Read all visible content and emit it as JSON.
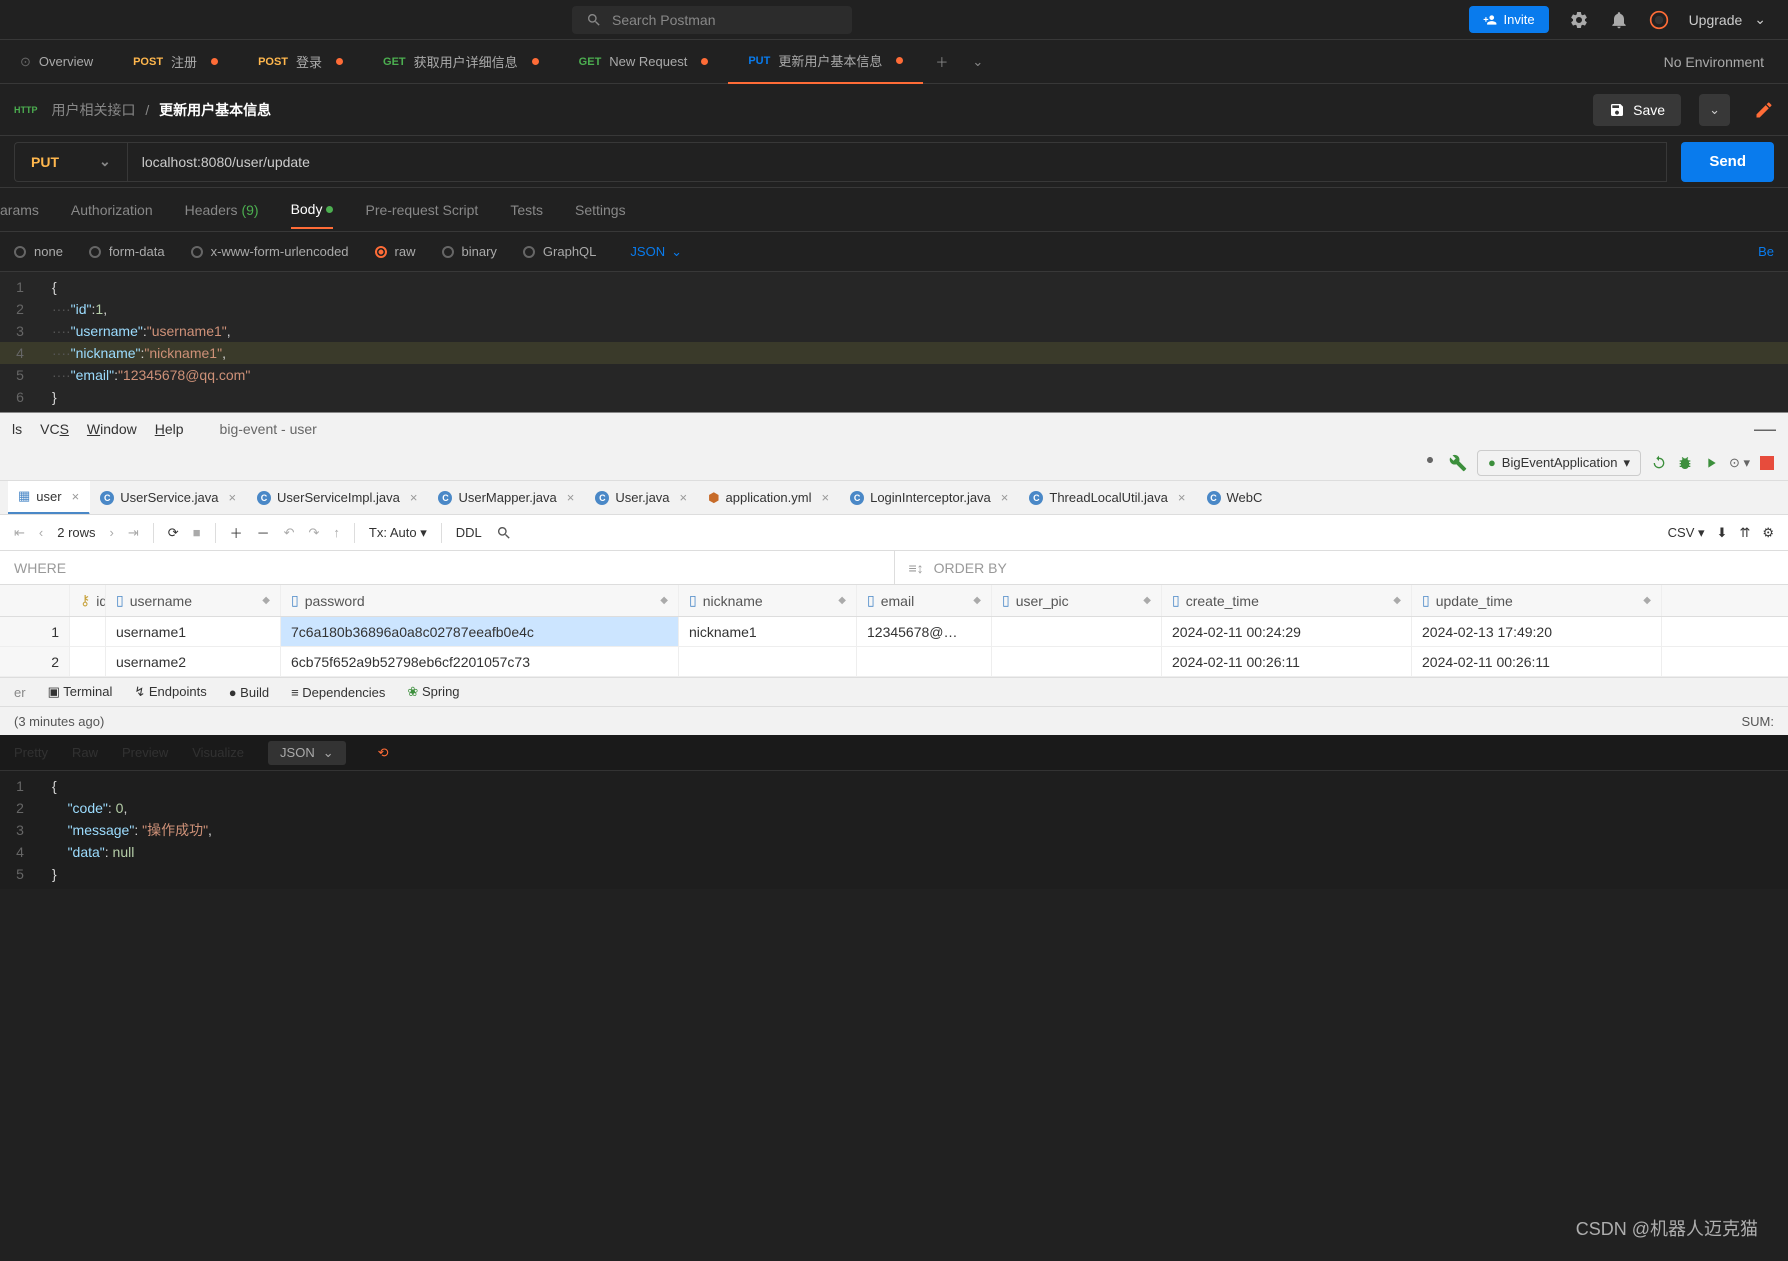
{
  "header": {
    "search_placeholder": "Search Postman",
    "invite_label": "Invite",
    "upgrade_label": "Upgrade"
  },
  "tabs": {
    "overview": "Overview",
    "items": [
      {
        "method": "POST",
        "label": "注册",
        "modified": true
      },
      {
        "method": "POST",
        "label": "登录",
        "modified": true
      },
      {
        "method": "GET",
        "label": "获取用户详细信息",
        "modified": true
      },
      {
        "method": "GET",
        "label": "New Request",
        "modified": true
      },
      {
        "method": "PUT",
        "label": "更新用户基本信息",
        "modified": true,
        "active": true
      }
    ],
    "no_environment": "No Environment"
  },
  "breadcrumb": {
    "http": "HTTP",
    "folder": "用户相关接口",
    "current": "更新用户基本信息",
    "save": "Save"
  },
  "request": {
    "method": "PUT",
    "url": "localhost:8080/user/update",
    "send": "Send"
  },
  "req_tabs": {
    "params": "Params",
    "auth": "Authorization",
    "headers": "Headers",
    "headers_count": "(9)",
    "body": "Body",
    "prerequest": "Pre-request Script",
    "tests": "Tests",
    "settings": "Settings"
  },
  "body_types": {
    "none": "none",
    "form": "form-data",
    "xwww": "x-www-form-urlencoded",
    "raw": "raw",
    "binary": "binary",
    "graphql": "GraphQL",
    "json": "JSON",
    "beautify": "Be"
  },
  "request_body": {
    "l1": "{",
    "l2_k": "\"id\"",
    "l2_v": "1",
    "l3_k": "\"username\"",
    "l3_v": "\"username1\"",
    "l4_k": "\"nickname\"",
    "l4_v": "\"nickname1\"",
    "l5_k": "\"email\"",
    "l5_v": "\"12345678@qq.com\"",
    "l6": "}"
  },
  "ide": {
    "menu": {
      "vcs": "VCS",
      "window": "Window",
      "help": "Help",
      "project": "big-event - user",
      "ls": "ls"
    },
    "run_config": "BigEventApplication",
    "tabs": [
      {
        "icon": "db",
        "label": "user",
        "active": true
      },
      {
        "icon": "c",
        "label": "UserService.java"
      },
      {
        "icon": "c",
        "label": "UserServiceImpl.java"
      },
      {
        "icon": "c",
        "label": "UserMapper.java"
      },
      {
        "icon": "c",
        "label": "User.java"
      },
      {
        "icon": "y",
        "label": "application.yml"
      },
      {
        "icon": "c",
        "label": "LoginInterceptor.java"
      },
      {
        "icon": "c",
        "label": "ThreadLocalUtil.java"
      },
      {
        "icon": "c",
        "label": "WebC"
      }
    ],
    "toolbar": {
      "rows": "2 rows",
      "tx": "Tx: Auto",
      "ddl": "DDL",
      "csv": "CSV"
    },
    "filters": {
      "where": "WHERE",
      "orderby": "ORDER BY"
    },
    "columns": [
      "id",
      "username",
      "password",
      "nickname",
      "email",
      "user_pic",
      "create_time",
      "update_time"
    ],
    "rows": [
      {
        "idx": "1",
        "id": "",
        "username": "username1",
        "password": "7c6a180b36896a0a8c02787eeafb0e4c",
        "nickname": "nickname1",
        "email": "12345678@…",
        "user_pic": "",
        "create_time": "2024-02-11 00:24:29",
        "update_time": "2024-02-13 17:49:20"
      },
      {
        "idx": "2",
        "id": "",
        "username": "username2",
        "password": "6cb75f652a9b52798eb6cf2201057c73",
        "nickname": "",
        "email": "",
        "user_pic": "",
        "create_time": "2024-02-11 00:26:11",
        "update_time": "2024-02-11 00:26:11"
      }
    ],
    "bottom": {
      "terminal": "Terminal",
      "endpoints": "Endpoints",
      "build": "Build",
      "dependencies": "Dependencies",
      "spring": "Spring"
    },
    "status": {
      "time": "(3 minutes ago)",
      "sum": "SUM:"
    }
  },
  "response_tabs": {
    "pretty": "Pretty",
    "raw": "Raw",
    "preview": "Preview",
    "visualize": "Visualize",
    "json": "JSON"
  },
  "response_body": {
    "l1": "{",
    "l2_k": "\"code\"",
    "l2_v": "0",
    "l3_k": "\"message\"",
    "l3_v": "\"操作成功\"",
    "l4_k": "\"data\"",
    "l4_v": "null",
    "l5": "}"
  },
  "watermark": "CSDN @机器人迈克猫"
}
